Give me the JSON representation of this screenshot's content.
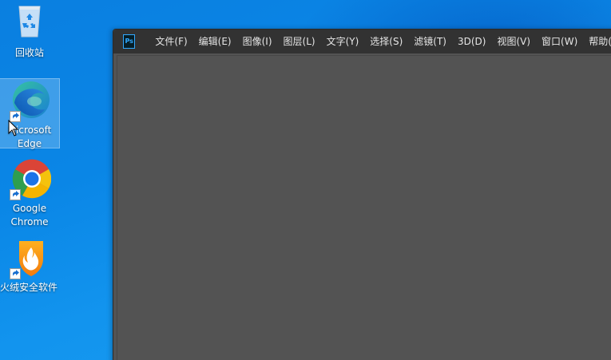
{
  "desktop": {
    "icons": [
      {
        "label": "回收站",
        "icon": "recycle-bin-icon"
      },
      {
        "label": "Microsoft Edge",
        "label_line1": "Microsoft",
        "label_line2": "Edge",
        "icon": "edge-icon"
      },
      {
        "label": "Google Chrome",
        "label_line1": "Google",
        "label_line2": "Chrome",
        "icon": "chrome-icon"
      },
      {
        "label": "火绒安全软件",
        "icon": "huorong-icon"
      }
    ]
  },
  "photoshop": {
    "logo_text": "Ps",
    "menu": [
      {
        "label": "文件(F)"
      },
      {
        "label": "编辑(E)"
      },
      {
        "label": "图像(I)"
      },
      {
        "label": "图层(L)"
      },
      {
        "label": "文字(Y)"
      },
      {
        "label": "选择(S)"
      },
      {
        "label": "滤镜(T)"
      },
      {
        "label": "3D(D)"
      },
      {
        "label": "视图(V)"
      },
      {
        "label": "窗口(W)"
      },
      {
        "label": "帮助(H"
      }
    ]
  },
  "colors": {
    "desktop_blue": "#0a86e6",
    "ps_menubar": "#323232",
    "ps_workspace": "#535353",
    "ps_accent": "#31a8ff"
  }
}
